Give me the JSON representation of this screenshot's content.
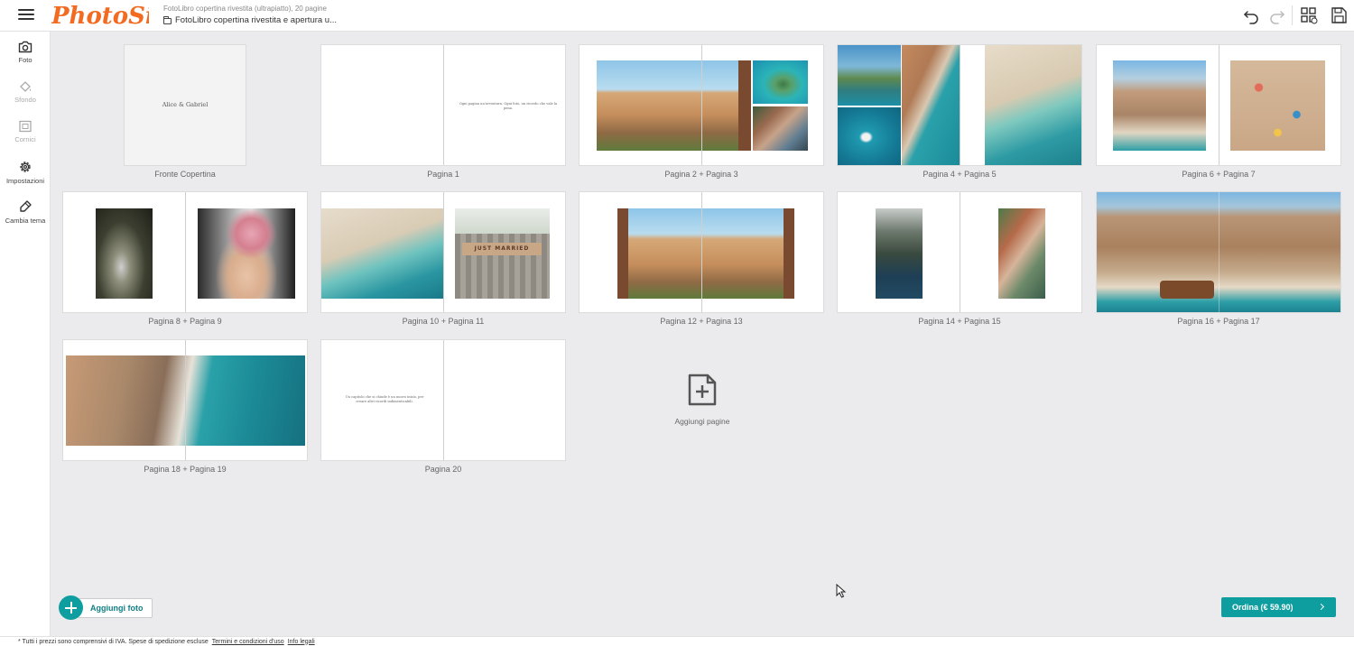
{
  "header": {
    "logo_text": "PhotoSi",
    "subtitle": "FotoLibro copertina rivestita (ultrapiatto), 20 pagine",
    "project_name": "FotoLibro copertina rivestita e apertura u...",
    "icons": [
      "menu-icon",
      "folder-icon",
      "undo-icon",
      "redo-icon",
      "grid-view-icon",
      "save-icon"
    ]
  },
  "sidebar": {
    "items": [
      {
        "label": "Foto",
        "icon": "camera-icon",
        "enabled": true
      },
      {
        "label": "Sfondo",
        "icon": "paint-bucket-icon",
        "enabled": false
      },
      {
        "label": "Cornici",
        "icon": "frame-icon",
        "enabled": false
      },
      {
        "label": "Impostazioni",
        "icon": "gear-icon",
        "enabled": true
      },
      {
        "label": "Cambia tema",
        "icon": "brush-icon",
        "enabled": true
      }
    ]
  },
  "pages": {
    "cover_label": "Fronte Copertina",
    "cover_text": "Alice & Gabriel",
    "p1_label": "Pagina 1",
    "p1_text": "Ogni pagina un'avventura. Ogni foto, un ricordo che vale la pena.",
    "p2_label": "Pagina 2 + Pagina 3",
    "p4_label": "Pagina 4 + Pagina 5",
    "p6_label": "Pagina 6 + Pagina 7",
    "p8_label": "Pagina 8 + Pagina 9",
    "p10_label": "Pagina 10 + Pagina 11",
    "p12_label": "Pagina 12 + Pagina 13",
    "p14_label": "Pagina 14 + Pagina 15",
    "p16_label": "Pagina 16 + Pagina 17",
    "p18_label": "Pagina 18 + Pagina 19",
    "p20_label": "Pagina 20",
    "p20_text": "Un capitolo che si chiude è un nuovo inizio, per creare altri ricordi indimenticabili.",
    "sign_text": "JUST MARRIED"
  },
  "actions": {
    "add_pages": "Aggiungi pagine",
    "add_photo": "Aggiungi foto",
    "order": "Ordina (€ 59.90)"
  },
  "footer": {
    "note": "* Tutti i prezzi sono comprensivi di IVA. Spese di spedizione escluse",
    "terms": "Termini e condizioni d'uso",
    "legal": "Info legali"
  },
  "colors": {
    "brand_orange": "#f26b21",
    "accent_teal": "#0f9ea0",
    "background": "#ebebed"
  }
}
